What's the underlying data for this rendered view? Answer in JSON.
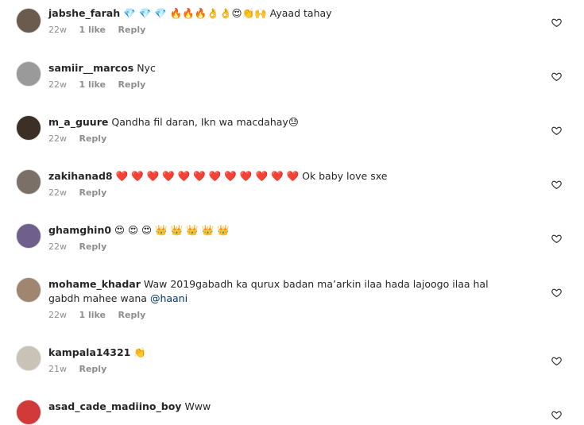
{
  "comments": [
    {
      "username": "jabshe_farah",
      "text": "💎 💎 💎 🔥🔥🔥👌👌😍👏🙌 Ayaad tahay",
      "time": "22w",
      "likes": "1 like",
      "reply": "Reply",
      "avatar_color": "#6b5a4e"
    },
    {
      "username": "samiir__marcos",
      "text": "Nyc",
      "time": "22w",
      "likes": "1 like",
      "reply": "Reply",
      "avatar_color": "#9a9a9a"
    },
    {
      "username": "m_a_guure",
      "text": "Qandha fil daran, Ikn wa macdahay😓",
      "time": "22w",
      "likes": "",
      "reply": "Reply",
      "avatar_color": "#3c3026"
    },
    {
      "username": "zakihanad8",
      "text": "❤️ ❤️ ❤️ ❤️ ❤️ ❤️ ❤️ ❤️ ❤️ ❤️ ❤️ ❤️ Ok baby love sxe",
      "time": "22w",
      "likes": "",
      "reply": "Reply",
      "avatar_color": "#7a7068"
    },
    {
      "username": "ghamghin0",
      "text": "😍 😍 😍 👑 👑 👑 👑 👑",
      "time": "22w",
      "likes": "",
      "reply": "Reply",
      "avatar_color": "#6f5f8c"
    },
    {
      "username": "mohame_khadar",
      "text": "Waw 2019gabadh ka qurux badan ma’arkin ilaa hada lajoogo ilaa hal gabdh mahee wana",
      "mention": "@haani",
      "time": "22w",
      "likes": "1 like",
      "reply": "Reply",
      "avatar_color": "#a08670"
    },
    {
      "username": "kampala14321",
      "text": "👏",
      "time": "21w",
      "likes": "",
      "reply": "Reply",
      "avatar_color": "#c9c2b6"
    },
    {
      "username": "asad_cade_madiino_boy",
      "text": "Www",
      "time": "",
      "likes": "",
      "reply": "",
      "avatar_color": "#d23a3a"
    }
  ]
}
